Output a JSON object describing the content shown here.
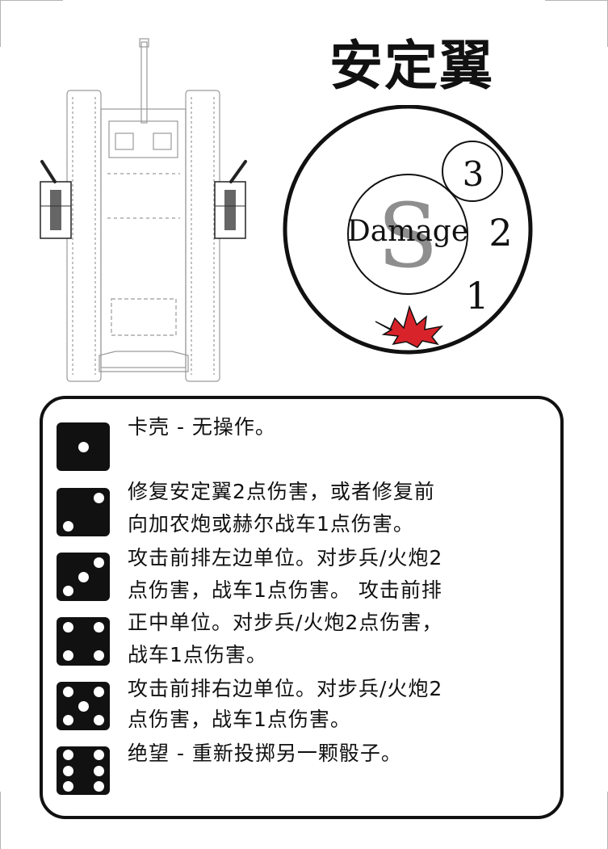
{
  "card": {
    "title": "安定翼"
  },
  "gauge": {
    "symbol": "S",
    "label": "Damage",
    "levels": [
      "3",
      "2",
      "1"
    ],
    "burst_color": "#d9232a"
  },
  "outcomes": [
    {
      "die_face": 1,
      "lines": [
        "卡壳 - 无操作。"
      ]
    },
    {
      "die_face": 2,
      "lines": [
        "修复安定翼2点伤害，或者修复前",
        "向加农炮或赫尔战车1点伤害。"
      ]
    },
    {
      "die_face": 3,
      "lines": [
        "攻击前排左边单位。对步兵/火炮2",
        "点伤害，战车1点伤害。 攻击前排"
      ]
    },
    {
      "die_face": 4,
      "lines": [
        "正中单位。对步兵/火炮2点伤害，",
        "战车1点伤害。"
      ]
    },
    {
      "die_face": 5,
      "lines": [
        "攻击前排右边单位。对步兵/火炮2",
        "点伤害，战车1点伤害。"
      ]
    },
    {
      "die_face": 6,
      "lines": [
        "绝望 - 重新投掷另一颗骰子。"
      ]
    }
  ]
}
